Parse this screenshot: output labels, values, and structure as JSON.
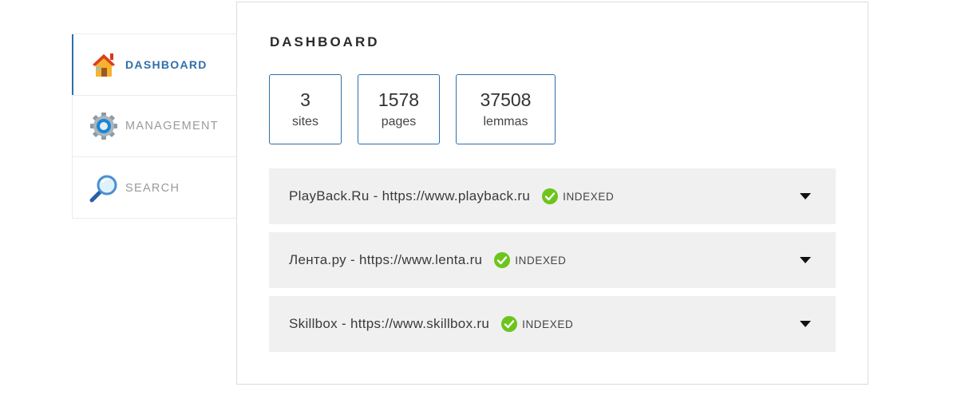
{
  "sidebar": {
    "items": [
      {
        "label": "DASHBOARD",
        "icon": "home-icon",
        "active": true
      },
      {
        "label": "MANAGEMENT",
        "icon": "gear-icon",
        "active": false
      },
      {
        "label": "SEARCH",
        "icon": "magnifier-icon",
        "active": false
      }
    ]
  },
  "main": {
    "title": "DASHBOARD",
    "stats": [
      {
        "value": "3",
        "label": "sites"
      },
      {
        "value": "1578",
        "label": "pages"
      },
      {
        "value": "37508",
        "label": "lemmas"
      }
    ],
    "sites": [
      {
        "name": "PlayBack.Ru - https://www.playback.ru",
        "status": "INDEXED"
      },
      {
        "name": "Лента.ру - https://www.lenta.ru",
        "status": "INDEXED"
      },
      {
        "name": "Skillbox - https://www.skillbox.ru",
        "status": "INDEXED"
      }
    ]
  },
  "colors": {
    "accent": "#2f6fa8",
    "row_bg": "#f0f0f0",
    "status_ok": "#6cc51c"
  }
}
